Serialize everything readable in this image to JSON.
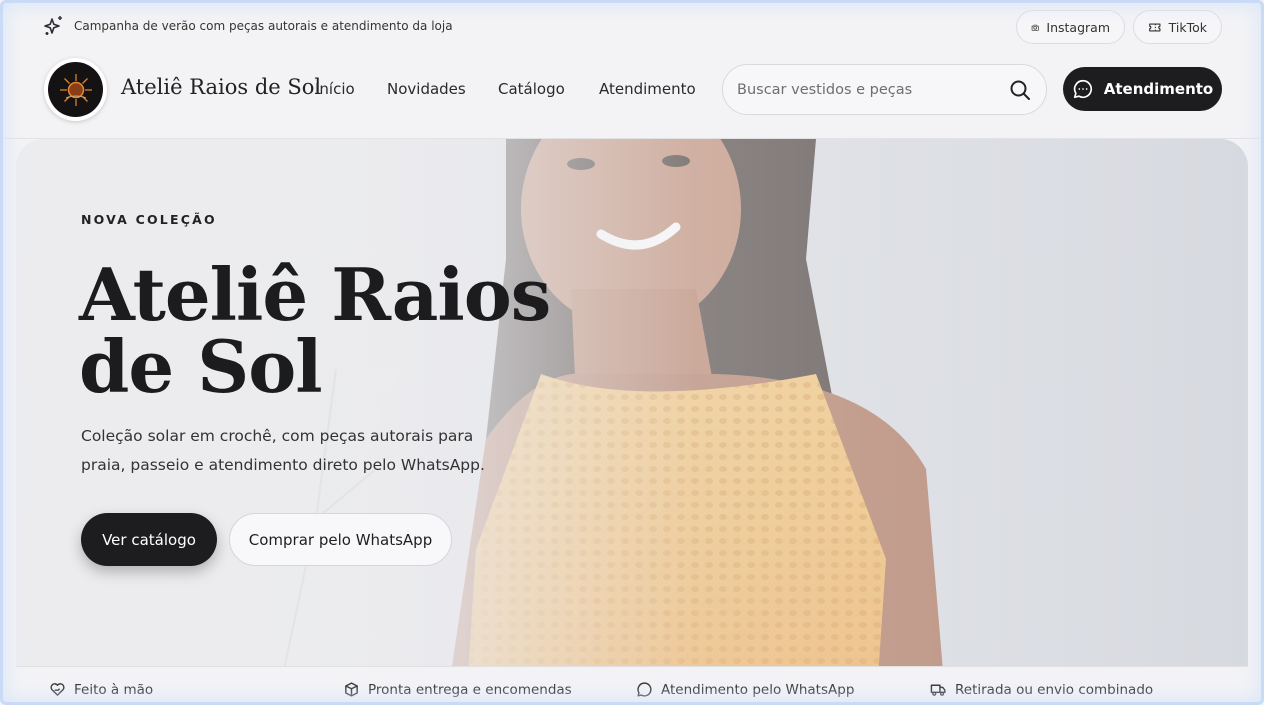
{
  "topbar": {
    "promo_text": "Campanha de verão com peças autorais e atendimento da loja",
    "social": [
      {
        "label": "Instagram",
        "icon": "camera-icon"
      },
      {
        "label": "TikTok",
        "icon": "ticket-icon"
      }
    ]
  },
  "header": {
    "brand": "Ateliê Raios de Sol",
    "nav": [
      "Início",
      "Novidades",
      "Catálogo",
      "Atendimento"
    ],
    "search_placeholder": "Buscar vestidos e peças",
    "cta_label": "Atendimento"
  },
  "hero": {
    "eyebrow": "NOVA COLEÇÃO",
    "title_line1": "Ateliê Raios",
    "title_line2": "de Sol",
    "description": "Coleção solar em crochê, com peças autorais para praia, passeio e atendimento direto pelo WhatsApp.",
    "primary_button": "Ver catálogo",
    "secondary_button": "Comprar pelo WhatsApp"
  },
  "features": [
    {
      "label": "Feito à mão",
      "icon": "heart-hand-icon"
    },
    {
      "label": "Pronta entrega e encomendas",
      "icon": "package-icon"
    },
    {
      "label": "Atendimento pelo WhatsApp",
      "icon": "chat-icon"
    },
    {
      "label": "Retirada ou envio combinado",
      "icon": "truck-icon"
    }
  ],
  "colors": {
    "dark_button": "#1d1d20",
    "page_background": "#f3f3f5",
    "crochet_top": "#f2b25a"
  }
}
